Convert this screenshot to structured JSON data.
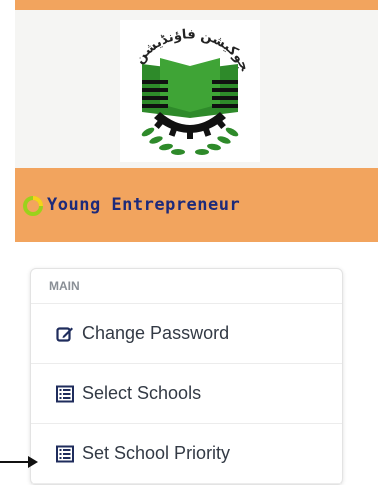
{
  "brand": {
    "name": "Young Entrepreneur",
    "logo_text": "پنجاب ایجوکیشن فاؤنڈیشن"
  },
  "menu": {
    "header": "MAIN",
    "items": [
      {
        "label": "Change Password",
        "icon": "edit-icon"
      },
      {
        "label": "Select Schools",
        "icon": "list-icon"
      },
      {
        "label": "Set School Priority",
        "icon": "list-icon"
      }
    ]
  },
  "colors": {
    "accent_orange": "#f2a45e",
    "brand_text": "#1d2a7a",
    "logo_green": "#2e8a2a",
    "icon_navy": "#1f2c5c"
  }
}
